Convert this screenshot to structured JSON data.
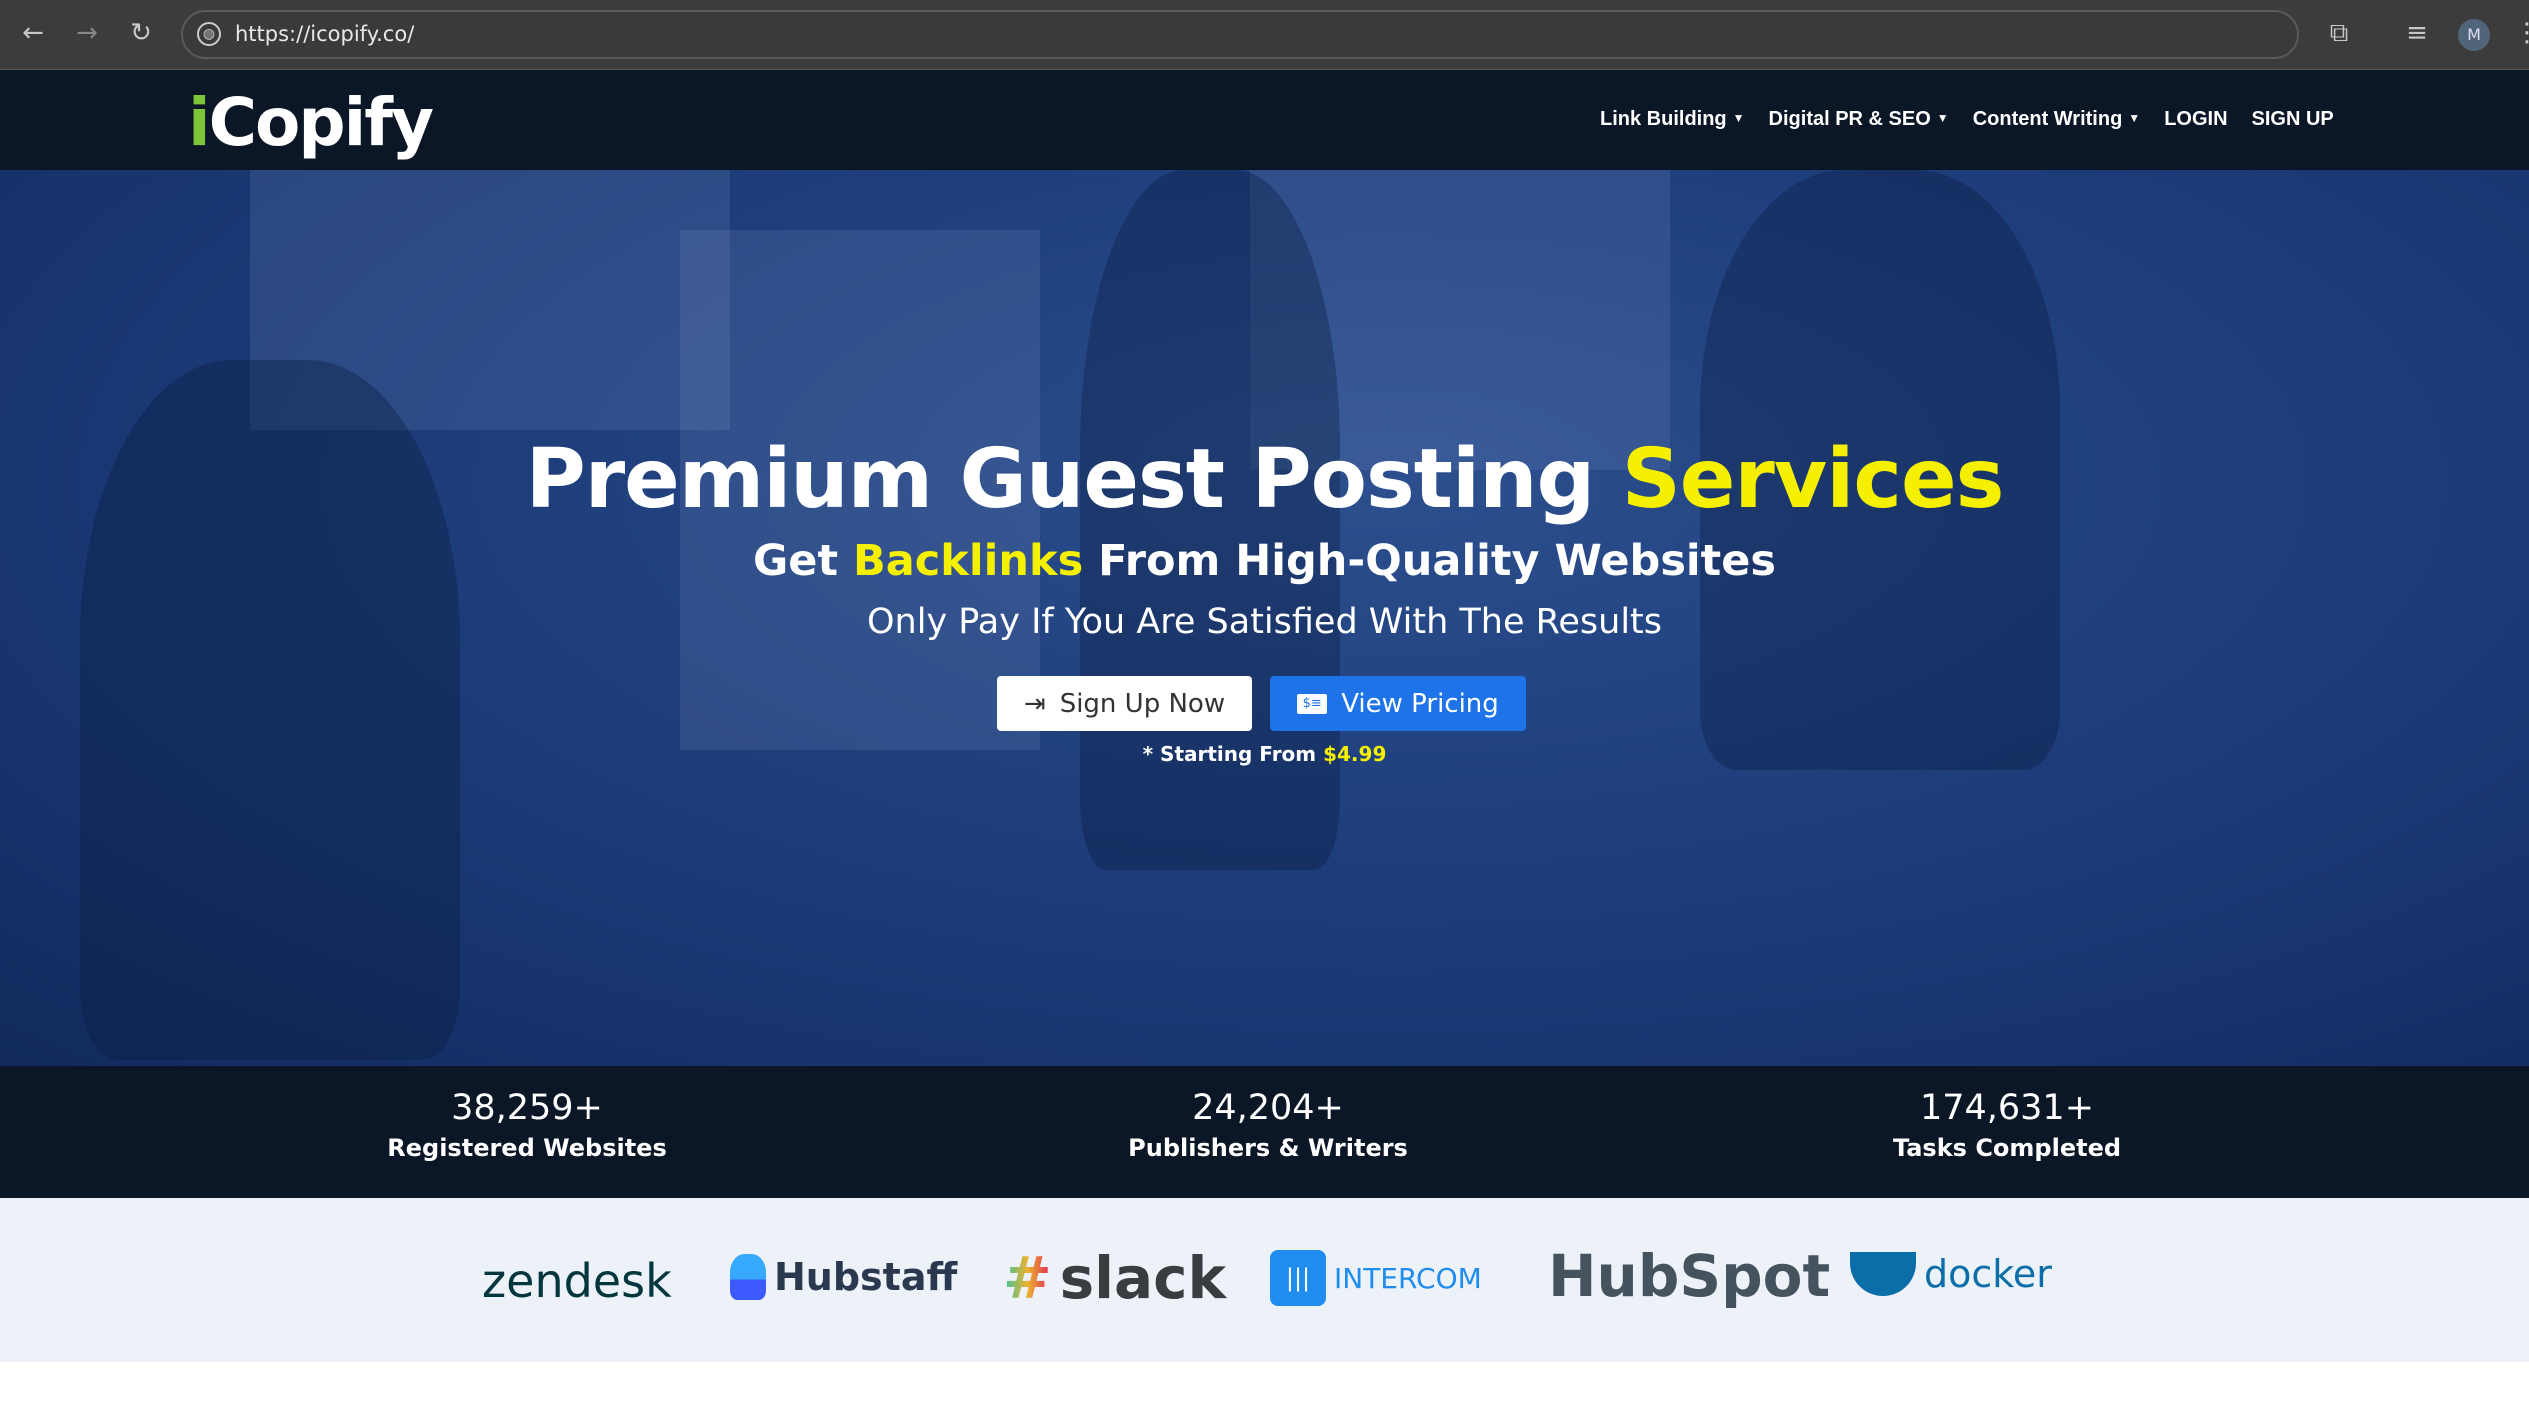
{
  "browser": {
    "url": "https://icopify.co/",
    "profile_initial": "M"
  },
  "nav": {
    "logo_i": "i",
    "logo_rest": "Copify",
    "items": [
      {
        "label": "Link Building",
        "dropdown": true
      },
      {
        "label": "Digital PR & SEO",
        "dropdown": true
      },
      {
        "label": "Content Writing",
        "dropdown": true
      },
      {
        "label": "LOGIN"
      },
      {
        "label": "SIGN UP"
      }
    ]
  },
  "hero": {
    "title_main": "Premium Guest Posting ",
    "title_highlight": "Services",
    "sub_pre": "Get ",
    "sub_highlight": "Backlinks",
    "sub_post": " From High-Quality Websites",
    "tagline": "Only Pay If You Are Satisfied With The Results",
    "signup_label": "Sign Up Now",
    "pricing_label": "View Pricing",
    "note_pre": "* Starting From ",
    "note_price": "$4.99",
    "highlight_color": "#f4f000"
  },
  "stats": [
    {
      "value": "38,259+",
      "label": "Registered Websites"
    },
    {
      "value": "24,204+",
      "label": "Publishers & Writers"
    },
    {
      "value": "174,631+",
      "label": "Tasks Completed"
    }
  ],
  "clients": {
    "zendesk": "zendesk",
    "hubstaff": "Hubstaff",
    "slack": "slack",
    "intercom": "INTERCOM",
    "hubspot": "HubSpot",
    "docker": "docker"
  }
}
